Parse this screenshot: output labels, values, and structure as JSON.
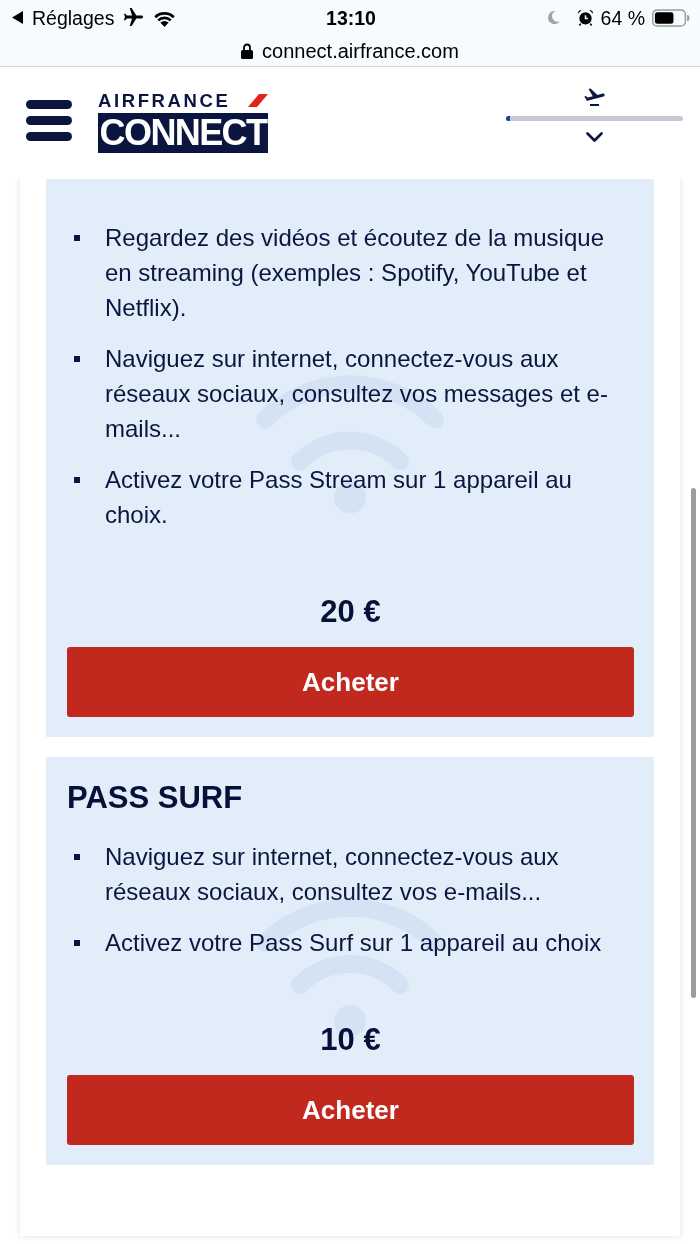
{
  "status_bar": {
    "back_label": "Réglages",
    "time": "13:10",
    "battery_percent": "64 %"
  },
  "address_bar": {
    "url": "connect.airfrance.com"
  },
  "header": {
    "brand": "AIRFRANCE",
    "product": "CONNECT",
    "flight_progress": {
      "level": 0.02
    }
  },
  "passes": [
    {
      "features": [
        "Regardez des vidéos et écoutez de la musique en streaming (exemples : Spotify, YouTube et Netflix).",
        "Naviguez sur internet, connectez-vous aux réseaux sociaux, consultez vos messages et e-mails...",
        "Activez votre Pass Stream sur 1 appareil au choix."
      ],
      "price": "20 €",
      "button": "Acheter"
    },
    {
      "title": "PASS SURF",
      "features": [
        "Naviguez sur internet, connectez-vous aux réseaux sociaux, consultez vos e-mails...",
        "Activez votre Pass Surf sur 1 appareil au choix"
      ],
      "price": "10 €",
      "button": "Acheter"
    }
  ]
}
